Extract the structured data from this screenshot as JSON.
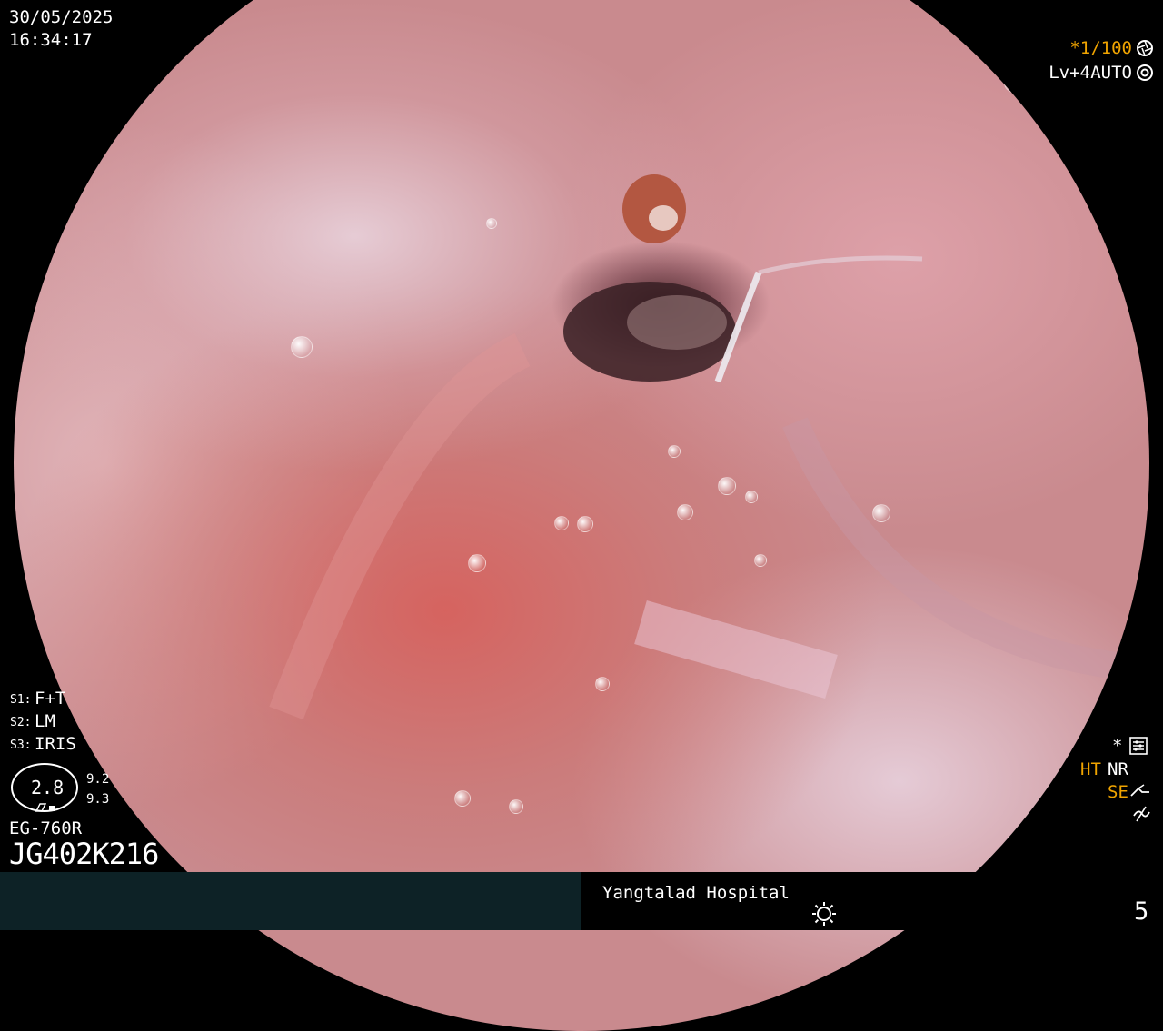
{
  "header": {
    "date": "30/05/2025",
    "time": "16:34:17"
  },
  "settings_top_right": {
    "shutter": "*1/100",
    "shutter_icon": "shutter-icon",
    "level": "Lv+4",
    "mode": "AUTO",
    "mode_icon": "auto-exposure-icon"
  },
  "scope_settings": {
    "s1_key": "S1:",
    "s1_value": "F+T",
    "s2_key": "S2:",
    "s2_value": "LM",
    "s3_key": "S3:",
    "s3_value": "IRIS",
    "zoom_value": "2.8",
    "zoom_side_top": "9.2",
    "zoom_side_bottom": "9.3",
    "zoom_icons": "camera-zoom-icon",
    "model": "EG-760R",
    "serial": "JG402K216"
  },
  "settings_bottom_right": {
    "star": "*",
    "star_icon": "settings-panel-icon",
    "ht": "HT",
    "nr": "NR",
    "se": "SE",
    "se_icon": "structure-enhance-icon",
    "extra_icon": "not-equal-icon"
  },
  "footer": {
    "hospital": "Yangtalad Hospital",
    "light_icon": "light-icon",
    "page_number": "5"
  },
  "colors": {
    "accent_orange": "#f0a400",
    "footer_left_bg": "#0d2226",
    "text": "#ffffff"
  }
}
